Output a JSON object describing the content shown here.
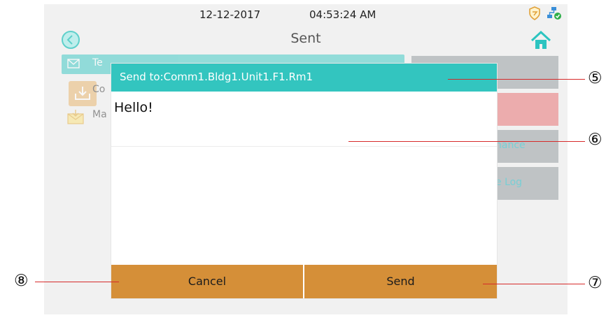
{
  "statusbar": {
    "date": "12-12-2017",
    "time": "04:53:24  AM",
    "shield_icon": "shield-icon",
    "network_icon": "network-status-icon"
  },
  "titlebar": {
    "title": "Sent",
    "back_icon": "back-icon",
    "home_icon": "home-icon"
  },
  "background_list": [
    {
      "label": "Te",
      "icon": "envelope-icon"
    },
    {
      "label": "Co",
      "icon": "inbox-icon"
    },
    {
      "label": "Ma",
      "icon": "mail-icon"
    }
  ],
  "side_buttons": [
    {
      "label": ""
    },
    {
      "label": ""
    },
    {
      "label": "nance"
    },
    {
      "label": "e Log"
    }
  ],
  "dialog": {
    "header": "Send to:Comm1.Bldg1.Unit1.F1.Rm1",
    "message": "Hello!",
    "cancel_label": "Cancel",
    "send_label": "Send"
  },
  "callouts": [
    "⑤",
    "⑥",
    "⑦",
    "⑧"
  ],
  "colors": {
    "accent": "#33c5bf",
    "button": "#d58f38",
    "callout_line": "#d62a2a"
  }
}
